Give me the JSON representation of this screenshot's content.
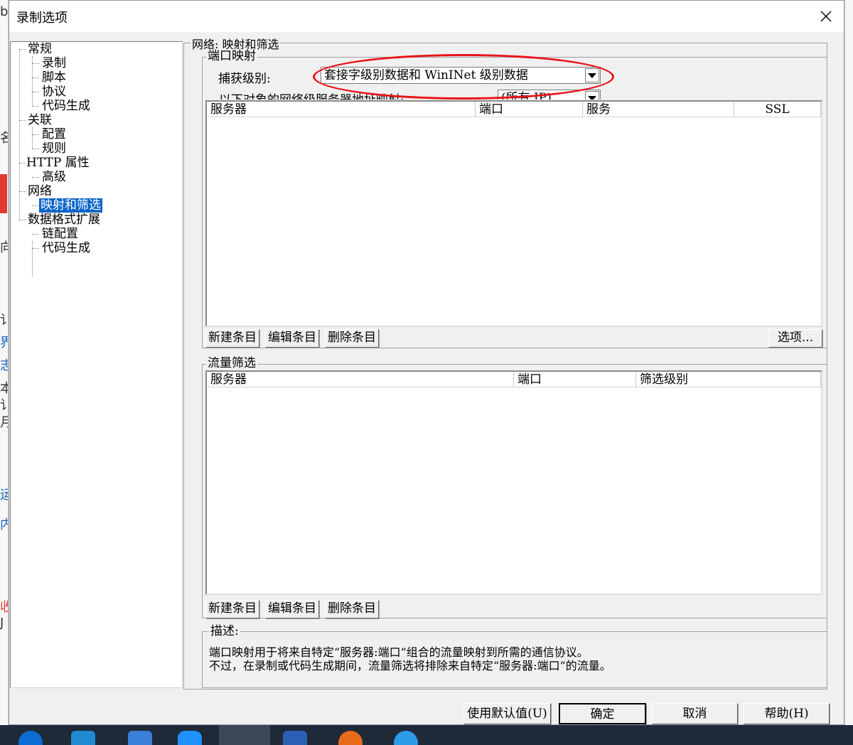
{
  "window": {
    "title": "录制选项",
    "close_symbol": "✕"
  },
  "background_app": {
    "glyphs": [
      "b",
      "名",
      "向",
      "讠",
      "界",
      "志",
      "本",
      "讠",
      "月",
      "运",
      "内",
      "收",
      "J"
    ]
  },
  "tree": {
    "items": [
      {
        "label": "常规",
        "level": 0
      },
      {
        "label": "录制",
        "level": 1
      },
      {
        "label": "脚本",
        "level": 1
      },
      {
        "label": "协议",
        "level": 1
      },
      {
        "label": "代码生成",
        "level": 1
      },
      {
        "label": "关联",
        "level": 0
      },
      {
        "label": "配置",
        "level": 1
      },
      {
        "label": "规则",
        "level": 1
      },
      {
        "label": "HTTP 属性",
        "level": 0
      },
      {
        "label": "高级",
        "level": 1
      },
      {
        "label": "网络",
        "level": 0
      },
      {
        "label": "映射和筛选",
        "level": 1,
        "selected": true
      },
      {
        "label": "数据格式扩展",
        "level": 0
      },
      {
        "label": "链配置",
        "level": 1
      },
      {
        "label": "代码生成",
        "level": 1
      }
    ]
  },
  "main": {
    "group_title": "网络: 映射和筛选",
    "port_mapping": {
      "title": "端口映射",
      "capture_label": "捕获级别:",
      "capture_value": "套接字级别数据和 WinINet 级别数据",
      "target_label": "以下对象的网络级服务器地址映射:",
      "target_value": "(所有 IP)",
      "columns": [
        "服务器",
        "端口",
        "服务",
        "SSL"
      ],
      "buttons": {
        "new": "新建条目",
        "edit": "编辑条目",
        "delete": "删除条目",
        "options": "选项..."
      }
    },
    "traffic_filter": {
      "title": "流量筛选",
      "columns": [
        "服务器",
        "端口",
        "筛选级别"
      ],
      "buttons": {
        "new": "新建条目",
        "edit": "编辑条目",
        "delete": "删除条目"
      }
    },
    "description": {
      "title": "描述:",
      "line1": "端口映射用于将来自特定“服务器:端口”组合的流量映射到所需的通信协议。",
      "line2": "不过，在录制或代码生成期间，流量筛选将排除来自特定“服务器:端口”的流量。"
    }
  },
  "footer": {
    "defaults_label": "使用默认值(U)",
    "ok_label": "确定",
    "cancel_label": "取消",
    "help_label": "帮助(H)"
  },
  "colors": {
    "selection": "#0a64c8",
    "annotation": "#e8141a",
    "taskbar": "#1e2a38"
  },
  "taskbar": {
    "icons": [
      "edge-icon",
      "vscode-icon",
      "media-player-icon",
      "browser-icon",
      "lock-app-icon",
      "word-icon",
      "firefox-icon",
      "ie-icon"
    ]
  }
}
